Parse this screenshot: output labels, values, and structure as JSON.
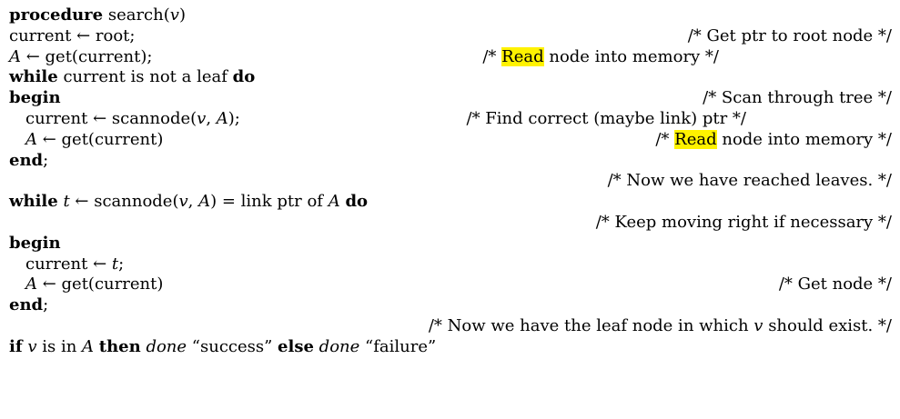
{
  "lines": [
    {
      "stmt": {
        "kw": "procedure",
        "text": " search(",
        "var": "v",
        "tail": ")"
      }
    },
    {
      "stmt_text": "current ← root;",
      "comment": "/* Get ptr to root node */"
    },
    {
      "stmt": {
        "var": "A",
        "text": " ← get(current);"
      },
      "comment": {
        "pre": "/* ",
        "hl": "Read",
        "post": " node into memory */"
      }
    },
    {
      "stmt": {
        "kw": "while",
        "text": " current is not a leaf ",
        "kw2": "do"
      }
    },
    {
      "stmt": {
        "kw": "begin"
      },
      "comment": "/* Scan through tree */"
    },
    {
      "stmt": {
        "text": "current ← scannode(",
        "var": "v",
        "sep": ", ",
        "var2": "A",
        "tail": ");"
      },
      "comment": "/* Find correct (maybe link) ptr */"
    },
    {
      "stmt": {
        "var": "A",
        "text": " ← get(current)"
      },
      "comment": {
        "pre": "/* ",
        "hl": "Read",
        "post": " node into memory */"
      }
    },
    {
      "stmt": {
        "kw": "end",
        "tail": ";"
      }
    },
    {
      "comment": "/* Now we have reached leaves. */"
    },
    {
      "stmt": {
        "kw": "while",
        "var": "t",
        "text": " ← scannode(",
        "var2": "v",
        "sep": ", ",
        "var3": "A",
        "tail": ") = link ptr of ",
        "var4": "A",
        "kw2": "do"
      }
    },
    {
      "comment": "/* Keep moving right if necessary */"
    },
    {
      "stmt": {
        "kw": "begin"
      }
    },
    {
      "stmt": {
        "text": "current ← ",
        "var": "t",
        "tail": ";"
      }
    },
    {
      "stmt": {
        "var": "A",
        "text": " ← get(current)"
      },
      "comment": "/* Get node */"
    },
    {
      "stmt": {
        "kw": "end",
        "tail": ";"
      }
    },
    {
      "comment": {
        "pre": "/* Now we have the leaf node in which ",
        "var": "v",
        "post": " should exist. */"
      }
    },
    {
      "stmt": {
        "kw": "if",
        "var": "v",
        "text": " is in ",
        "var2": "A",
        "kw2": "then",
        "it": "done",
        "str": "“success”",
        "kw3": "else",
        "it2": "done",
        "str2": "“failure”"
      }
    }
  ]
}
